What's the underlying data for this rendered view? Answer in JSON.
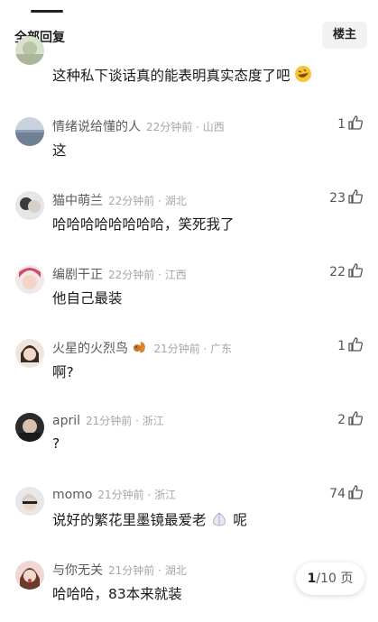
{
  "header": {
    "title": "全部回复",
    "op_button": "楼主"
  },
  "comments": [
    {
      "user": "",
      "time": "",
      "text": "这种私下谈话真的能表明真实态度了吧",
      "likes": "",
      "user_emoji": "",
      "text_emoji": "rofl-face"
    },
    {
      "user": "情绪说给懂的人",
      "time": "22分钟前 · 山西",
      "text": "这",
      "likes": "1",
      "user_emoji": "",
      "text_emoji": ""
    },
    {
      "user": "猫中萌兰",
      "time": "22分钟前 · 湖北",
      "text": "哈哈哈哈哈哈哈哈，笑死我了",
      "likes": "23",
      "user_emoji": "",
      "text_emoji": ""
    },
    {
      "user": "编剧干正",
      "time": "22分钟前 · 江西",
      "text": "他自己最装",
      "likes": "22",
      "user_emoji": "",
      "text_emoji": ""
    },
    {
      "user": "火星的火烈鸟",
      "time": "21分钟前 · 广东",
      "text": "啊?",
      "likes": "1",
      "user_emoji": "squirrel",
      "text_emoji": ""
    },
    {
      "user": "april",
      "time": "21分钟前 · 浙江",
      "text": "?",
      "likes": "2",
      "user_emoji": "",
      "text_emoji": ""
    },
    {
      "user": "momo",
      "time": "21分钟前 · 浙江",
      "text": "说好的繁花里墨镜最爱老",
      "text_after": "呢",
      "likes": "74",
      "user_emoji": "",
      "text_emoji": "garlic"
    },
    {
      "user": "与你无关",
      "time": "21分钟前 · 湖北",
      "text": "哈哈哈，83本来就装",
      "likes": "",
      "user_emoji": "",
      "text_emoji": ""
    }
  ],
  "pager": {
    "current": "1",
    "total_label": "/10 页"
  },
  "colors": {
    "username": "#5a5a5a",
    "time": "#a6a6a6",
    "text": "#1a1a1a"
  }
}
